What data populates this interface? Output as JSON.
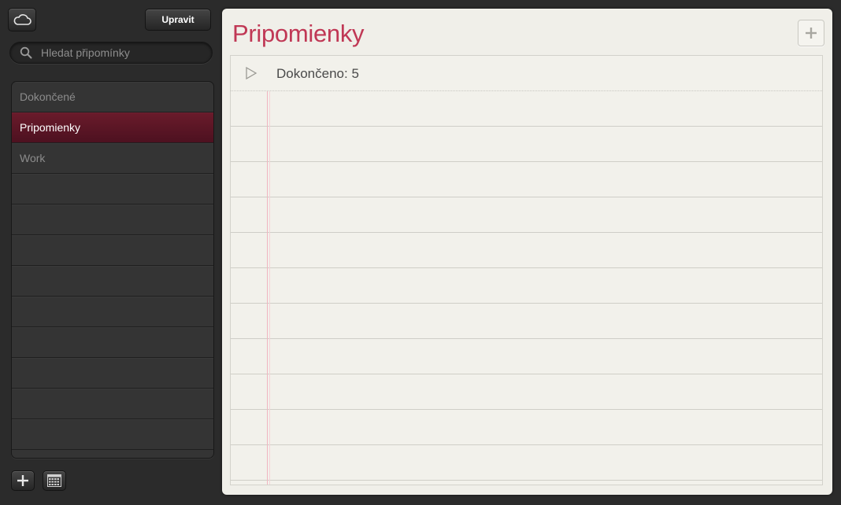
{
  "sidebar": {
    "edit_label": "Upravit",
    "search_placeholder": "Hledat připomínky",
    "lists": [
      {
        "label": "Dokončené",
        "selected": false
      },
      {
        "label": "Pripomienky",
        "selected": true
      },
      {
        "label": "Work",
        "selected": false
      }
    ],
    "empty_rows": 9,
    "icons": {
      "cloud": "cloud-icon",
      "search": "search-icon",
      "add": "plus-icon",
      "calendar": "calendar-icon"
    }
  },
  "main": {
    "title": "Pripomienky",
    "completed_label": "Dokončeno: 5"
  },
  "colors": {
    "accent": "#c03855",
    "selected_row": "#5b1525",
    "paper": "#f0efe9",
    "margin_line": "#f0b5c0"
  }
}
